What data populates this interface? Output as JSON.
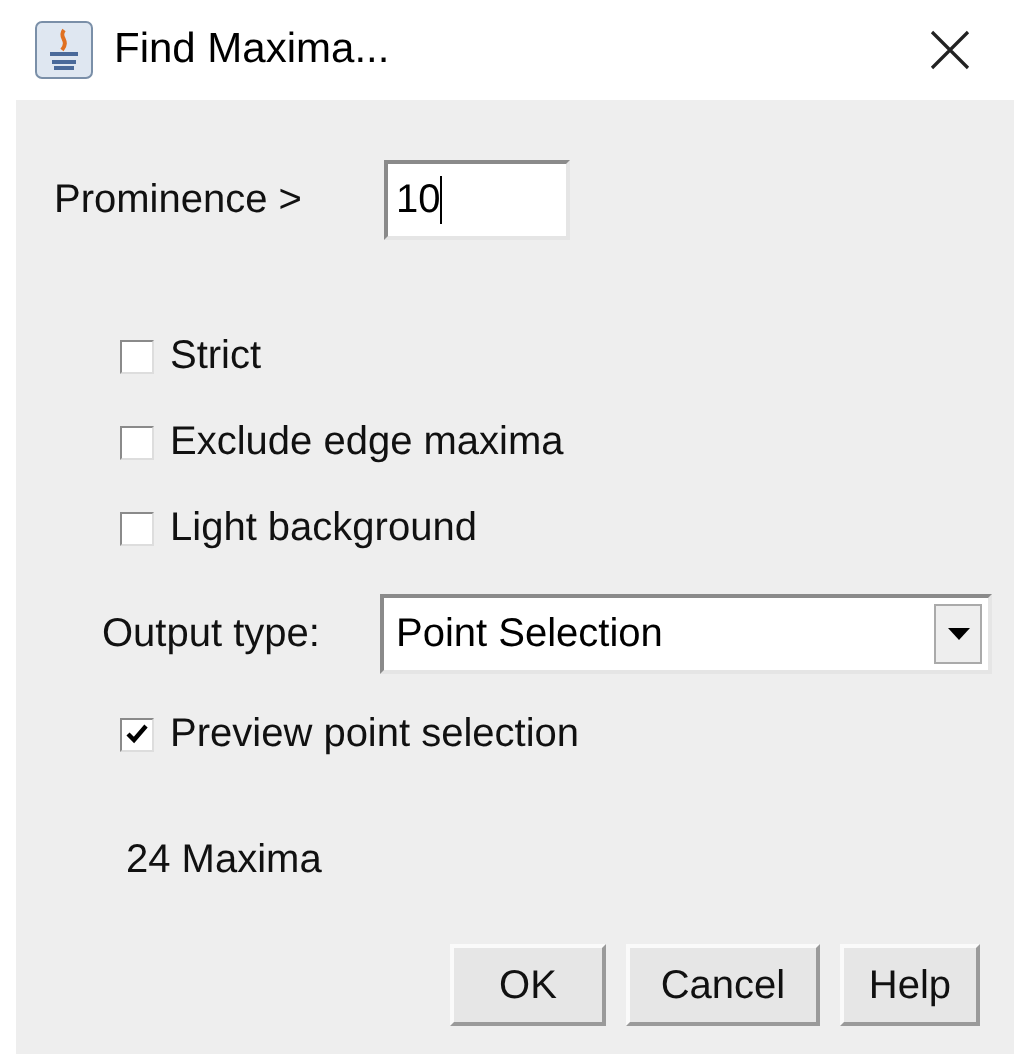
{
  "window": {
    "title": "Find Maxima..."
  },
  "prominence": {
    "label": "Prominence >",
    "value": "10"
  },
  "options": [
    {
      "label": "Strict",
      "checked": false
    },
    {
      "label": "Exclude edge maxima",
      "checked": false
    },
    {
      "label": "Light background",
      "checked": false
    }
  ],
  "output_type": {
    "label": "Output type:",
    "value": "Point Selection"
  },
  "preview": {
    "label": "Preview point selection",
    "checked": true
  },
  "result": "24 Maxima",
  "buttons": [
    "OK",
    "Cancel",
    "Help"
  ]
}
